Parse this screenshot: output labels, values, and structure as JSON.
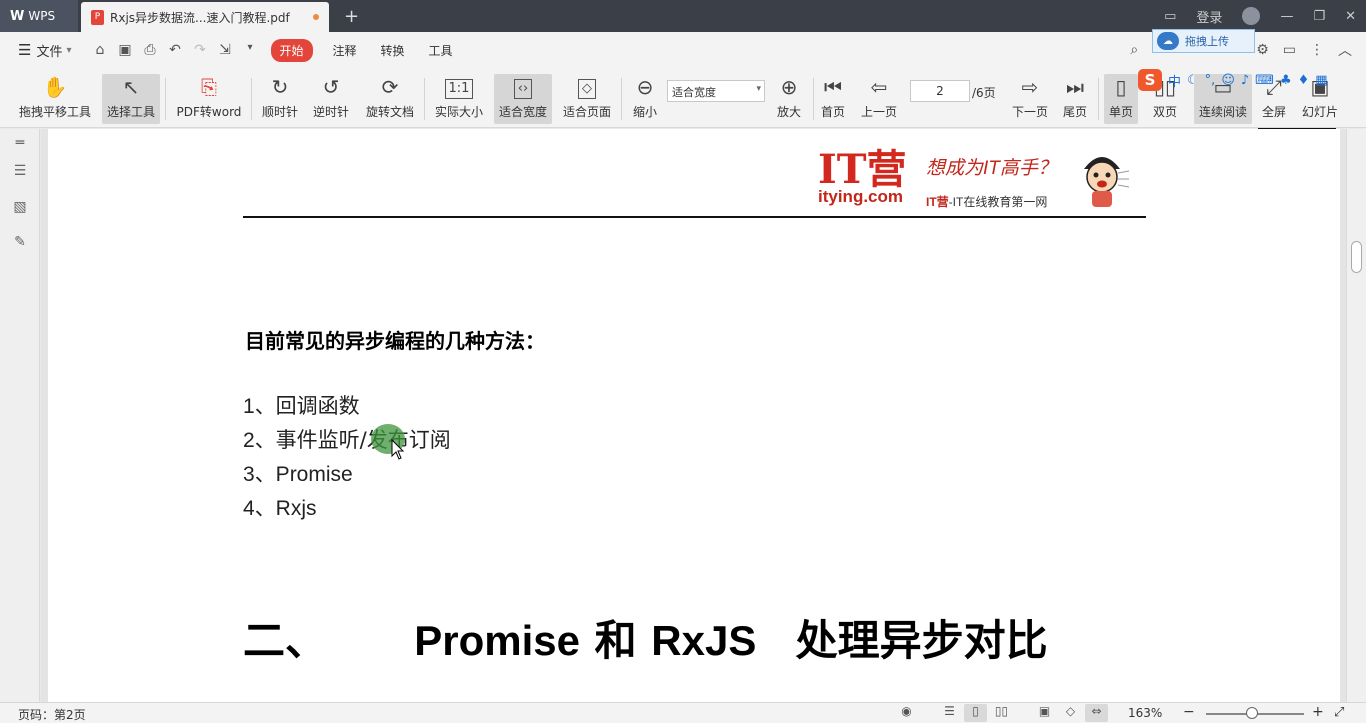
{
  "titlebar": {
    "app_tab": "WPS",
    "doc_tab": "Rxjs异步数据流...速入门教程.pdf",
    "new_tab": "+",
    "login": "登录",
    "minimize": "—",
    "restore": "❐",
    "close": "✕"
  },
  "menubar": {
    "file": "文件",
    "tabs": [
      "开始",
      "注释",
      "转换",
      "工具"
    ],
    "upload_popup": "拖拽上传"
  },
  "toolbar": {
    "pan": "拖拽平移工具",
    "select": "选择工具",
    "pdf2word": "PDF转word",
    "clockwise": "顺时针",
    "counterclockwise": "逆时针",
    "rotate_doc": "旋转文档",
    "actual_size": "实际大小",
    "fit_width": "适合宽度",
    "fit_page": "适合页面",
    "zoom_out": "缩小",
    "fit_select": "适合宽度",
    "zoom_in": "放大",
    "first_page": "首页",
    "prev_page": "上一页",
    "page_input": "2",
    "page_total": "/6页",
    "next_page": "下一页",
    "last_page": "尾页",
    "single_page": "单页",
    "double_page": "双页",
    "continuous": "连续阅读",
    "fullscreen": "全屏",
    "slideshow": "幻灯片"
  },
  "ime": {
    "logo": "S",
    "mode": "中"
  },
  "document": {
    "logo_it": "IT营",
    "logo_url": "itying.com",
    "logo_slogan": "想成为IT高手？",
    "logo_sub_brand": "IT营",
    "logo_sub_text": "-IT在线教育第一网",
    "heading": "目前常见的异步编程的几种方法：",
    "list": [
      {
        "num": "1",
        "text": "、回调函数"
      },
      {
        "num": "2",
        "text": "、事件监听/发布订阅"
      },
      {
        "num": "3",
        "text": "、Promise"
      },
      {
        "num": "4",
        "text": "、Rxjs"
      }
    ],
    "big_heading_prefix": "二、",
    "big_heading_promise": "Promise",
    "big_heading_and": "和",
    "big_heading_rxjs": "RxJS",
    "big_heading_suffix": "处理异步对比"
  },
  "statusbar": {
    "page_info": "页码：第2页",
    "zoom": "163%"
  },
  "colors": {
    "accent_red": "#e4453a",
    "brand_red": "#c3261b",
    "highlight_green": "#3f963e",
    "titlebar_bg": "#3b4048"
  }
}
